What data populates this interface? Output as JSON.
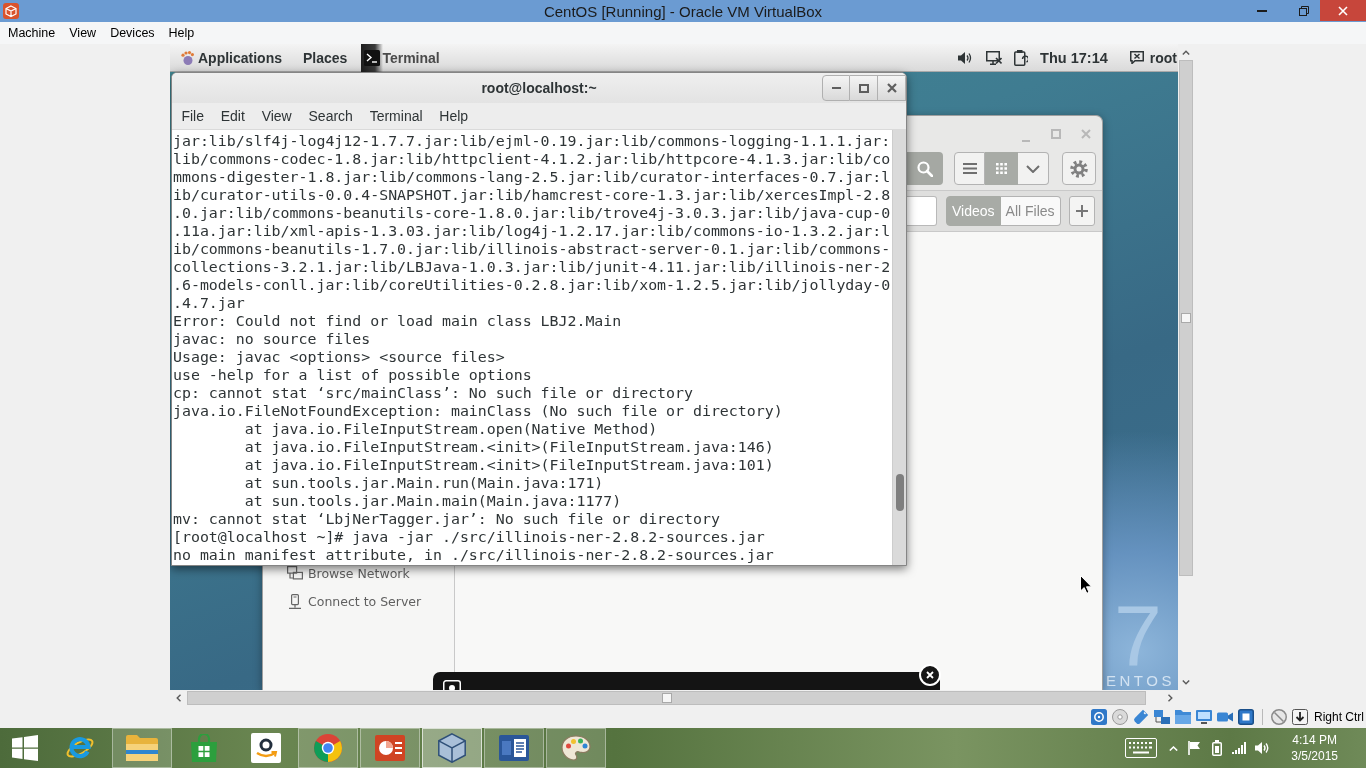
{
  "host_window": {
    "title": "CentOS [Running] - Oracle VM VirtualBox",
    "menu": [
      "Machine",
      "View",
      "Devices",
      "Help"
    ]
  },
  "guest_top_bar": {
    "menus": [
      "Applications",
      "Places"
    ],
    "window_list": [
      {
        "label": "Terminal"
      }
    ],
    "clock": "Thu 17:14",
    "user": "root"
  },
  "files_window": {
    "view_buttons": [
      {
        "selected": false
      },
      {
        "selected": true
      }
    ],
    "filters": [
      {
        "label": "Videos",
        "selected": true
      },
      {
        "label": "All Files",
        "selected": false
      }
    ],
    "sidebar": [
      {
        "label": "Browse Network"
      },
      {
        "label": "Connect to Server"
      }
    ]
  },
  "terminal_window": {
    "title": "root@localhost:~",
    "menu": [
      "File",
      "Edit",
      "View",
      "Search",
      "Terminal",
      "Help"
    ],
    "lines": [
      "jar:lib/slf4j-log4j12-1.7.7.jar:lib/ejml-0.19.jar:lib/commons-logging-1.1.1.jar:",
      "lib/commons-codec-1.8.jar:lib/httpclient-4.1.2.jar:lib/httpcore-4.1.3.jar:lib/co",
      "mmons-digester-1.8.jar:lib/commons-lang-2.5.jar:lib/curator-interfaces-0.7.jar:l",
      "ib/curator-utils-0.0.4-SNAPSHOT.jar:lib/hamcrest-core-1.3.jar:lib/xercesImpl-2.8",
      ".0.jar:lib/commons-beanutils-core-1.8.0.jar:lib/trove4j-3.0.3.jar:lib/java-cup-0",
      ".11a.jar:lib/xml-apis-1.3.03.jar:lib/log4j-1.2.17.jar:lib/commons-io-1.3.2.jar:l",
      "ib/commons-beanutils-1.7.0.jar:lib/illinois-abstract-server-0.1.jar:lib/commons-",
      "collections-3.2.1.jar:lib/LBJava-1.0.3.jar:lib/junit-4.11.jar:lib/illinois-ner-2",
      ".6-models-conll.jar:lib/coreUtilities-0.2.8.jar:lib/xom-1.2.5.jar:lib/jollyday-0",
      ".4.7.jar",
      "Error: Could not find or load main class LBJ2.Main",
      "javac: no source files",
      "Usage: javac <options> <source files>",
      "use -help for a list of possible options",
      "cp: cannot stat ‘src/mainClass’: No such file or directory",
      "java.io.FileNotFoundException: mainClass (No such file or directory)",
      "        at java.io.FileInputStream.open(Native Method)",
      "        at java.io.FileInputStream.<init>(FileInputStream.java:146)",
      "        at java.io.FileInputStream.<init>(FileInputStream.java:101)",
      "        at sun.tools.jar.Main.run(Main.java:171)",
      "        at sun.tools.jar.Main.main(Main.java:1177)",
      "mv: cannot stat ‘LbjNerTagger.jar’: No such file or directory",
      "[root@localhost ~]# java -jar ./src/illinois-ner-2.8.2-sources.jar",
      "no main manifest attribute, in ./src/illinois-ner-2.8.2-sources.jar"
    ]
  },
  "wallpaper": {
    "numeral": "7",
    "wordmark": "ENTOS"
  },
  "status_bar": {
    "host_key": "Right Ctrl"
  },
  "taskbar": {
    "apps": [
      {
        "running": false,
        "selected": false
      },
      {
        "running": true,
        "selected": false
      },
      {
        "running": false,
        "selected": false
      },
      {
        "running": false,
        "selected": false
      },
      {
        "running": true,
        "selected": false
      },
      {
        "running": true,
        "selected": false
      },
      {
        "running": true,
        "selected": true
      },
      {
        "running": true,
        "selected": false
      },
      {
        "running": true,
        "selected": false
      }
    ],
    "clock": {
      "time": "4:14 PM",
      "date": "3/5/2015"
    }
  }
}
